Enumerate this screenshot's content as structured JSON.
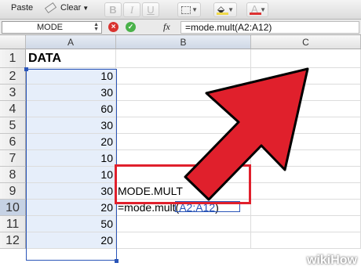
{
  "toolbar": {
    "paste_label": "Paste",
    "clear_label": "Clear",
    "bold_label": "B",
    "italic_label": "I",
    "underline_label": "U",
    "font_color_label": "A"
  },
  "formula_bar": {
    "name_box": "MODE",
    "fx_label": "fx",
    "formula": "=mode.mult(A2:A12)"
  },
  "columns": [
    "A",
    "B",
    "C"
  ],
  "rows": [
    {
      "num": "1",
      "a": "DATA",
      "b": ""
    },
    {
      "num": "2",
      "a": "10",
      "b": ""
    },
    {
      "num": "3",
      "a": "30",
      "b": ""
    },
    {
      "num": "4",
      "a": "60",
      "b": ""
    },
    {
      "num": "5",
      "a": "30",
      "b": ""
    },
    {
      "num": "6",
      "a": "20",
      "b": ""
    },
    {
      "num": "7",
      "a": "10",
      "b": ""
    },
    {
      "num": "8",
      "a": "10",
      "b": ""
    },
    {
      "num": "9",
      "a": "30",
      "b": "MODE.MULT"
    },
    {
      "num": "10",
      "a": "20",
      "b_prefix": "=mode.mult(",
      "b_ref": "A2:A12",
      "b_suffix": ")"
    },
    {
      "num": "11",
      "a": "50",
      "b": ""
    },
    {
      "num": "12",
      "a": "20",
      "b": ""
    }
  ],
  "watermark": {
    "wiki": "wiki",
    "how": "How"
  },
  "colors": {
    "arrow": "#e0202c",
    "highlight_box": "#e0202c",
    "selection": "#2a55b8"
  }
}
